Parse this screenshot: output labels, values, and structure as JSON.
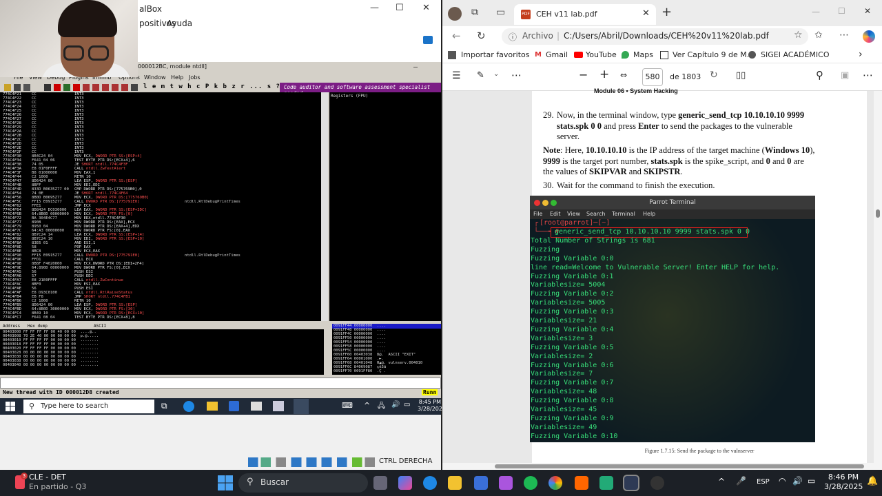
{
  "vbox": {
    "title": "alBox",
    "menu": [
      "positivos",
      "Ayuda"
    ],
    "status_key": "CTRL DERECHA"
  },
  "olly": {
    "title": "000012BC, module ntdll]",
    "menu": [
      "File",
      "View",
      "Debug",
      "Plugins",
      "Immlib",
      "Options",
      "Window",
      "Help",
      "Jobs"
    ],
    "toolbar_letters": "l e m t w h c P k b z r ... s ?",
    "banner": "Code auditor and software assessment specialist needed",
    "registers_header": "Registers (FPU)",
    "cpu_rows": [
      {
        "a": "774C4F21",
        "h": "CC",
        "o": "INT3",
        "r": "",
        "c": ""
      },
      {
        "a": "774C4F22",
        "h": "CC",
        "o": "INT3",
        "r": "",
        "c": ""
      },
      {
        "a": "774C4F23",
        "h": "CC",
        "o": "INT3",
        "r": "",
        "c": ""
      },
      {
        "a": "774C4F24",
        "h": "CC",
        "o": "INT3",
        "r": "",
        "c": ""
      },
      {
        "a": "774C4F25",
        "h": "CC",
        "o": "INT3",
        "r": "",
        "c": ""
      },
      {
        "a": "774C4F26",
        "h": "CC",
        "o": "INT3",
        "r": "",
        "c": ""
      },
      {
        "a": "774C4F27",
        "h": "CC",
        "o": "INT3",
        "r": "",
        "c": ""
      },
      {
        "a": "774C4F28",
        "h": "CC",
        "o": "INT3",
        "r": "",
        "c": ""
      },
      {
        "a": "774C4F29",
        "h": "CC",
        "o": "INT3",
        "r": "",
        "c": ""
      },
      {
        "a": "774C4F2A",
        "h": "CC",
        "o": "INT3",
        "r": "",
        "c": ""
      },
      {
        "a": "774C4F2B",
        "h": "CC",
        "o": "INT3",
        "r": "",
        "c": ""
      },
      {
        "a": "774C4F2C",
        "h": "CC",
        "o": "INT3",
        "r": "",
        "c": ""
      },
      {
        "a": "774C4F2D",
        "h": "CC",
        "o": "INT3",
        "r": "",
        "c": ""
      },
      {
        "a": "774C4F2E",
        "h": "CC",
        "o": "INT3",
        "r": "",
        "c": ""
      },
      {
        "a": "774C4F2F",
        "h": "CC",
        "o": "INT3",
        "r": "",
        "c": ""
      },
      {
        "a": "774C4F30",
        "h": "8B4C24 04",
        "o": "MOV ECX,",
        "r": "DWORD PTR SS:[ESP+4]",
        "c": ""
      },
      {
        "a": "774C4F34",
        "h": "F641 04 06",
        "o": "TEST BYTE PTR DS:[ECX+4],6",
        "r": "",
        "c": ""
      },
      {
        "a": "774C4F38",
        "h": "74 05",
        "o": "JE",
        "r": "SHORT ntdll.774C4F3F",
        "c": ""
      },
      {
        "a": "774C4F3A",
        "h": "E8 01F0FFFF",
        "o": "CALL",
        "r": "ntdll.ZwTestAlert",
        "c": ""
      },
      {
        "a": "774C4F3F",
        "h": "B8 01000000",
        "o": "MOV EAX,1",
        "r": "",
        "c": ""
      },
      {
        "a": "774C4F44",
        "h": "C2 1000",
        "o": "RETN 10",
        "r": "",
        "c": ""
      },
      {
        "a": "774C4F47",
        "h": "8D6424 00",
        "o": "LEA ESP,",
        "r": "DWORD PTR SS:[ESP]",
        "c": ""
      },
      {
        "a": "774C4F4B",
        "h": "8BFF",
        "o": "MOV EDI,EDI",
        "r": "",
        "c": ""
      },
      {
        "a": "774C4F4D",
        "h": "833D B0635Z77 00",
        "o": "CMP DWORD PTR DS:[775769B0],0",
        "r": "",
        "c": ""
      },
      {
        "a": "774C4F54",
        "h": "74 0E",
        "o": "JE",
        "r": "SHORT ntdll.774C4F64",
        "c": ""
      },
      {
        "a": "774C4F56",
        "h": "8B0D B0695Z77",
        "o": "MOV ECX,",
        "r": "DWORD PTR DS:[775769B0]",
        "c": ""
      },
      {
        "a": "774C4F5C",
        "h": "FF15 E0915Z77",
        "o": "CALL",
        "r": "DWORD PTR DS:[775791E0]",
        "c": "ntdll.RtlDebugPrintTimes"
      },
      {
        "a": "774C4F62",
        "h": "FFE1",
        "o": "JMP ECX",
        "r": "",
        "c": ""
      },
      {
        "a": "774C4F64",
        "h": "8D8424 DC030000",
        "o": "LEA EAX,",
        "r": "DWORD PTR SS:[ESP+3DC]",
        "c": ""
      },
      {
        "a": "774C4F6B",
        "h": "64:8B0D 00000000",
        "o": "MOV ECX,",
        "r": "DWORD PTR FS:[0]",
        "c": ""
      },
      {
        "a": "774C4F72",
        "h": "BA 304E4C77",
        "o": "MOV EDX,ntdll.774C4F30",
        "r": "",
        "c": ""
      },
      {
        "a": "774C4F77",
        "h": "8908",
        "o": "MOV DWORD PTR DS:[EAX],ECX",
        "r": "",
        "c": ""
      },
      {
        "a": "774C4F79",
        "h": "8950 04",
        "o": "MOV DWORD PTR DS:[EAX+4],EDX",
        "r": "",
        "c": ""
      },
      {
        "a": "774C4F7C",
        "h": "64:A3 00000000",
        "o": "MOV DWORD PTR FS:[0],EAX",
        "r": "",
        "c": ""
      },
      {
        "a": "774C4F82",
        "h": "8B7C24 14",
        "o": "LEA ECX,",
        "r": "DWORD PTR SS:[ESP+14]",
        "c": ""
      },
      {
        "a": "774C4F86",
        "h": "8B7C24 10",
        "o": "MOV EDI,",
        "r": "DWORD PTR SS:[ESP+10]",
        "c": ""
      },
      {
        "a": "774C4F8A",
        "h": "83E6 01",
        "o": "AND ESI,1",
        "r": "",
        "c": ""
      },
      {
        "a": "774C4F8D",
        "h": "58",
        "o": "POP EAX",
        "r": "",
        "c": ""
      },
      {
        "a": "774C4F8E",
        "h": "8BC8",
        "o": "MOV ECX,EAX",
        "r": "",
        "c": ""
      },
      {
        "a": "774C4F90",
        "h": "FF15 E0915Z77",
        "o": "CALL",
        "r": "DWORD PTR DS:[775791E0]",
        "c": "ntdll.RtlDebugPrintTimes"
      },
      {
        "a": "774C4F96",
        "h": "FFD1",
        "o": "CALL ECX",
        "r": "",
        "c": ""
      },
      {
        "a": "774C4F98",
        "h": "8B8F F4020000",
        "o": "MOV ECX,DWORD PTR DS:[EDI+2F4]",
        "r": "",
        "c": ""
      },
      {
        "a": "774C4F9E",
        "h": "64:890D 00000000",
        "o": "MOV DWORD PTR FS:[0],ECX",
        "r": "",
        "c": ""
      },
      {
        "a": "774C4FA5",
        "h": "56",
        "o": "PUSH ESI",
        "r": "",
        "c": ""
      },
      {
        "a": "774C4FA6",
        "h": "57",
        "o": "PUSH EDI",
        "r": "",
        "c": ""
      },
      {
        "a": "774C4FA7",
        "h": "E8 21E0FFFF",
        "o": "CALL",
        "r": "ntdll.ZwContinue",
        "c": ""
      },
      {
        "a": "774C4FAC",
        "h": "8BF0",
        "o": "MOV ESI,EAX",
        "r": "",
        "c": ""
      },
      {
        "a": "774C4FAE",
        "h": "56",
        "o": "PUSH ESI",
        "r": "",
        "c": ""
      },
      {
        "a": "774C4FAF",
        "h": "E8 D93C0100",
        "o": "CALL",
        "r": "ntdll.RtlRaiseStatus",
        "c": ""
      },
      {
        "a": "774C4FB4",
        "h": "EB F8",
        "o": "JMP",
        "r": "SHORT ntdll.774C4FB1",
        "c": ""
      },
      {
        "a": "774C4FB6",
        "h": "C2 1000",
        "o": "RETN 10",
        "r": "",
        "c": ""
      },
      {
        "a": "774C4FB9",
        "h": "8D6424 00",
        "o": "LEA ESP,",
        "r": "DWORD PTR SS:[ESP]",
        "c": ""
      },
      {
        "a": "774C4FBD",
        "h": "64:8B0D 30000000",
        "o": "MOV ECX,",
        "r": "DWORD PTR FS:[30]",
        "c": ""
      },
      {
        "a": "774C4FC4",
        "h": "8B49 10",
        "o": "MOV ECX,",
        "r": "DWORD PTR DS:[ECX+10]",
        "c": ""
      },
      {
        "a": "774C4FC7",
        "h": "F641 08 04",
        "o": "TEST BYTE PTR DS:[ECX+8],8",
        "r": "",
        "c": ""
      }
    ],
    "dump_headers": [
      "Address",
      "Hex dump",
      "ASCII"
    ],
    "dump_rows": [
      "00403000 FF FF FF FF 00 40 00 00  ....@..",
      "00403008 70 2E 40 00 00 00 00 00  p.@.....",
      "00403010 FF FF FF FF 00 00 00 00  ........",
      "00403018 FF FF FF FF 00 00 00 00  ........",
      "00403020 FF FF FF FF 00 00 00 00  ........",
      "00403028 00 00 00 00 00 00 00 00  ........",
      "00403030 00 00 00 00 00 00 00 00  ........",
      "00403038 00 00 00 00 00 00 00 00  ........",
      "00403040 00 00 00 00 00 00 00 00  ........"
    ],
    "stack_rows": [
      "0091FF44 00000000  ....",
      "0091FF48 00000000  ....",
      "0091FF4C 00000000  ....",
      "0091FF50 00000000  ....",
      "0091FF54 00000000  ....",
      "0091FF58 00000000  ....",
      "0091FF5C 00000000  ....",
      "0091FF60 00403038  8@.  ASCII \"EXIT\"",
      "0091FF64 00001000  .►.",
      "0091FF68 00401048  H▲@. vulnserv.004010",
      "0091FF6C 84069087  çë3ä",
      "0091FF70 0091FF80  .Ç ."
    ],
    "status_text": "New thread with ID 000012D8 created",
    "status_right": "Runn"
  },
  "vm_taskbar": {
    "search_placeholder": "Type here to search",
    "time": "8:45 PM",
    "date": "3/28/202"
  },
  "edge": {
    "tab_title": "CEH v11 lab.pdf",
    "address_label": "Archivo",
    "url": "C:/Users/Abril/Downloads/CEH%20v11%20lab.pdf",
    "favorites": [
      "Importar favoritos",
      "Gmail",
      "YouTube",
      "Maps",
      "Ver Capítulo 9 de M...",
      "SIGEI ACADÉMICO"
    ],
    "page_number": "580",
    "page_total": "de 1803",
    "pdf": {
      "module_header": "Module 06 • System Hacking",
      "step29_num": "29.",
      "step29_a": "Now, in the terminal window, type ",
      "step29_cmd": "generic_send_tcp 10.10.10.10 9999 stats.spk 0 0",
      "step29_b": " and press ",
      "step29_enter": "Enter",
      "step29_c": " to send the packages to the vulnerable server.",
      "note_label": "Note",
      "note_a": ": Here, ",
      "note_ip": "10.10.10.10",
      "note_b": " is the IP address of the target machine (",
      "note_win": "Windows 10",
      "note_c": "), ",
      "note_port": "9999",
      "note_d": " is the target port number, ",
      "note_spk": "stats.spk",
      "note_e": " is the spike_script, and ",
      "note_zero1": "0",
      "note_f": " and ",
      "note_zero2": "0",
      "note_g": " are the values of ",
      "note_skipvar": "SKIPVAR",
      "note_h": " and ",
      "note_skipstr": "SKIPSTR",
      "note_i": ".",
      "step30_num": "30.",
      "step30": "Wait for the command to finish the execution.",
      "caption": "Figure 1.7.15: Send the package to the vulnserver"
    },
    "terminal": {
      "title": "Parrot Terminal",
      "menu": [
        "File",
        "Edit",
        "View",
        "Search",
        "Terminal",
        "Help"
      ],
      "prompt": "[root@parrot]─[~]",
      "lines": [
        "generic_send_tcp 10.10.10.10 9999 stats.spk 0 0",
        "Total Number of Strings is 681",
        "Fuzzing",
        "Fuzzing Variable 0:0",
        "line read=Welcome to Vulnerable Server! Enter HELP for help.",
        "Fuzzing Variable 0:1",
        "Variablesize= 5004",
        "Fuzzing Variable 0:2",
        "Variablesize= 5005",
        "Fuzzing Variable 0:3",
        "Variablesize= 21",
        "Fuzzing Variable 0:4",
        "Variablesize= 3",
        "Fuzzing Variable 0:5",
        "Variablesize= 2",
        "Fuzzing Variable 0:6",
        "Variablesize= 7",
        "Fuzzing Variable 0:7",
        "Variablesize= 48",
        "Fuzzing Variable 0:8",
        "Variablesize= 45",
        "Fuzzing Variable 0:9",
        "Variablesize= 49",
        "Fuzzing Variable 0:10"
      ]
    }
  },
  "host_taskbar": {
    "weather_badge": "3",
    "weather_title": "CLE - DET",
    "weather_sub": "En partido - Q3",
    "search": "Buscar",
    "lang": "ESP",
    "time": "8:46 PM",
    "date": "3/28/2025"
  },
  "colors": {
    "accent": "#0b57d0",
    "olly_banner": "#7c1d85",
    "terminal_green": "#38e07a",
    "highlight": "#e0201c"
  }
}
